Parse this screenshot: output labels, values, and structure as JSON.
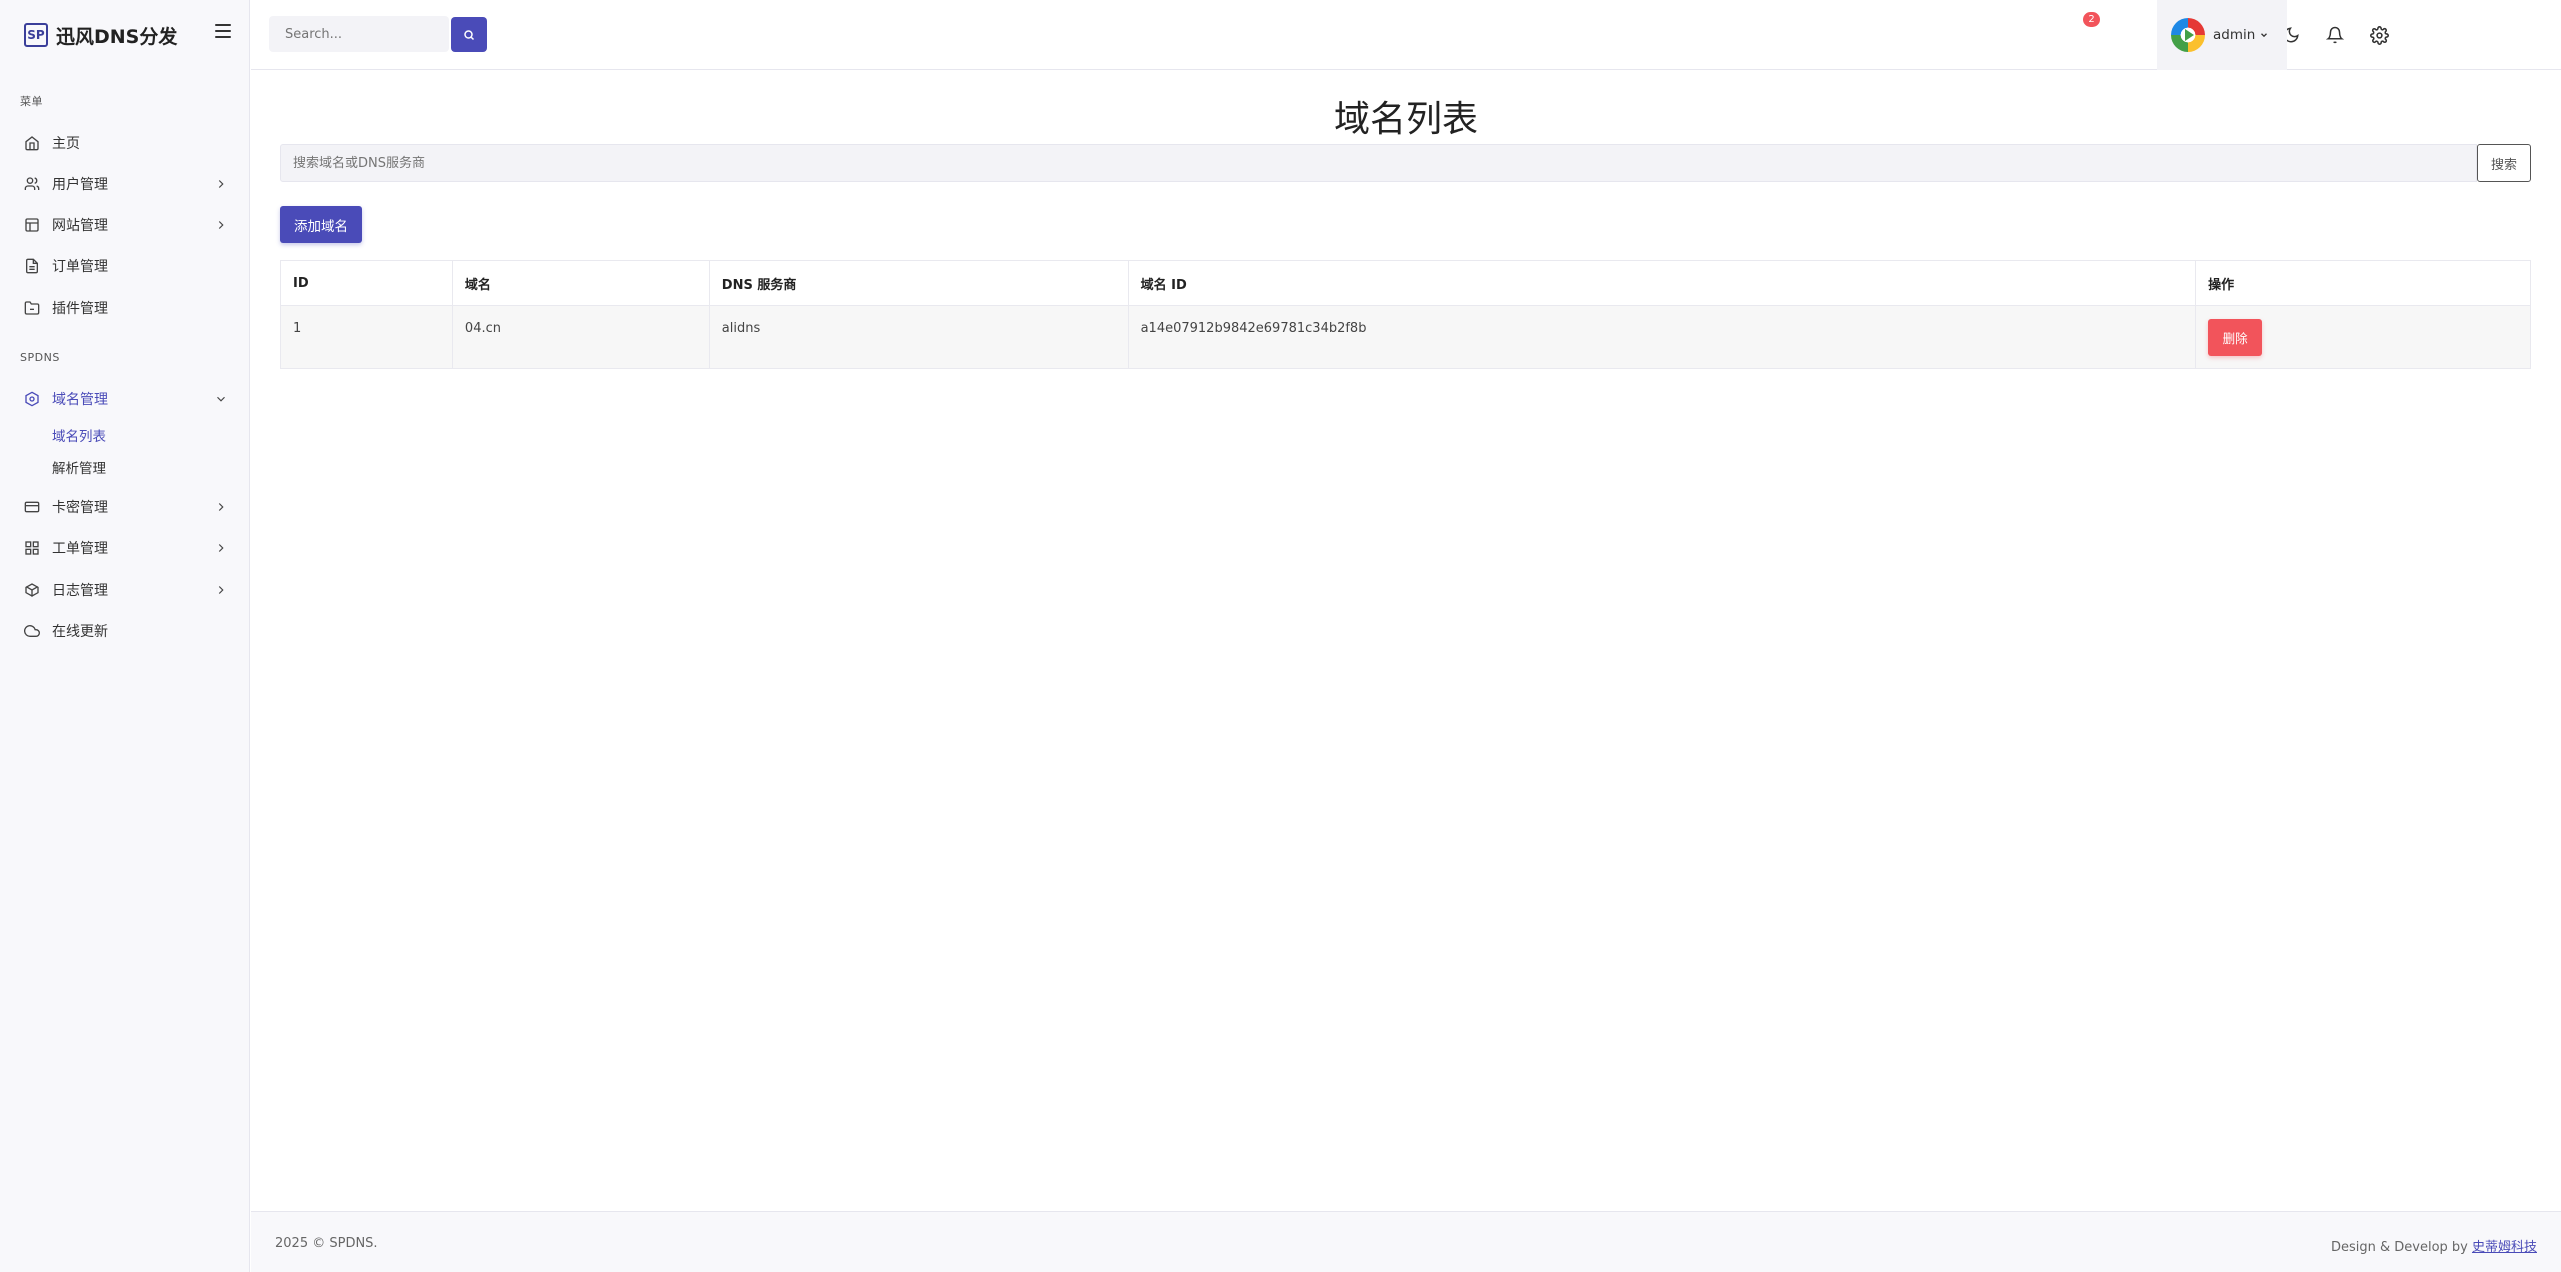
{
  "brand": {
    "logo_text": "SP",
    "name": "迅风DNS分发"
  },
  "topbar": {
    "search_placeholder": "Search...",
    "notification_count": "2",
    "user_name": "admin"
  },
  "sidebar": {
    "section_menu": "菜单",
    "section_spdns": "SPDNS",
    "items": [
      {
        "label": "主页",
        "icon": "home-icon"
      },
      {
        "label": "用户管理",
        "icon": "users-icon"
      },
      {
        "label": "网站管理",
        "icon": "layout-icon"
      },
      {
        "label": "订单管理",
        "icon": "file-icon"
      },
      {
        "label": "插件管理",
        "icon": "folder-icon"
      }
    ],
    "dns_items": [
      {
        "label": "域名管理",
        "icon": "hexagon-icon"
      },
      {
        "label": "卡密管理",
        "icon": "card-icon"
      },
      {
        "label": "工单管理",
        "icon": "grid-icon"
      },
      {
        "label": "日志管理",
        "icon": "box-icon"
      },
      {
        "label": "在线更新",
        "icon": "cloud-icon"
      }
    ],
    "sub_items": [
      "域名列表",
      "解析管理"
    ]
  },
  "main": {
    "title": "域名列表",
    "filter_placeholder": "搜索域名或DNS服务商",
    "filter_button": "搜索",
    "add_button": "添加域名",
    "table": {
      "headers": [
        "ID",
        "域名",
        "DNS 服务商",
        "域名 ID",
        "操作"
      ],
      "rows": [
        {
          "id": "1",
          "domain": "04.cn",
          "provider": "alidns",
          "domain_id": "a14e07912b9842e69781c34b2f8b",
          "action": "删除"
        }
      ]
    }
  },
  "footer": {
    "copyright": "2025 © SPDNS.",
    "credit_prefix": "Design & Develop by ",
    "credit_link": "史蒂姆科技"
  },
  "colors": {
    "accent": "#4a4bb8",
    "danger": "#f2545b"
  }
}
